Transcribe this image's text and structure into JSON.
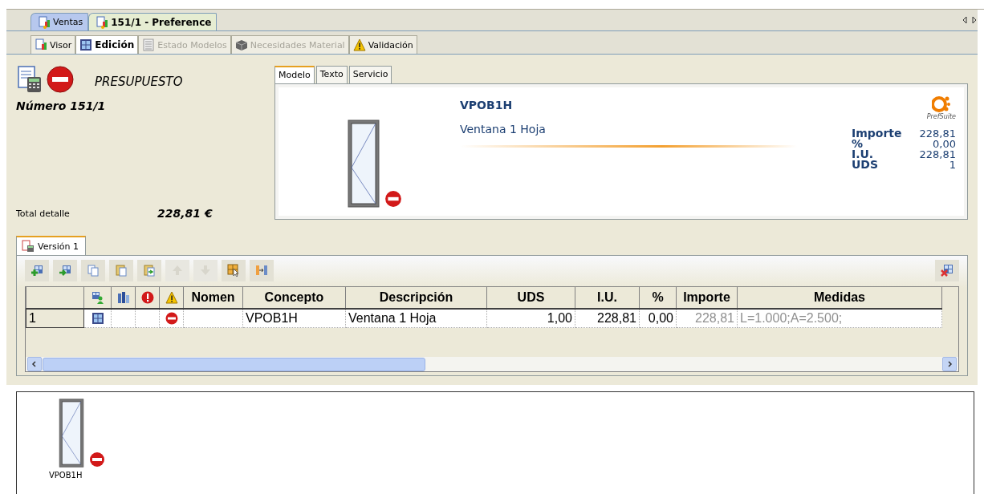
{
  "document_tabs": [
    {
      "label": "Ventas",
      "selected": false
    },
    {
      "label": "151/1 - Preference",
      "selected": true
    }
  ],
  "view_tabs": [
    {
      "label": "Visor",
      "kind": "doc",
      "selected": false,
      "disabled": false
    },
    {
      "label": "Edición",
      "kind": "grid",
      "selected": true,
      "disabled": false
    },
    {
      "label": "Estado Modelos",
      "kind": "list",
      "selected": false,
      "disabled": true
    },
    {
      "label": "Necesidades Material",
      "kind": "box",
      "selected": false,
      "disabled": true
    },
    {
      "label": "Validación",
      "kind": "warning",
      "selected": false,
      "disabled": false
    }
  ],
  "header": {
    "title": "PRESUPUESTO",
    "number": "Número 151/1",
    "total_label": "Total detalle",
    "total_value": "228,81 €"
  },
  "model_card": {
    "tabs": [
      {
        "label": "Modelo",
        "selected": true
      },
      {
        "label": "Texto",
        "selected": false
      },
      {
        "label": "Servicio",
        "selected": false
      }
    ],
    "code": "VPOB1H",
    "description": "Ventana 1 Hoja",
    "logo_text": "PrefSuite",
    "summary": [
      {
        "label": "Importe",
        "value": "228,81"
      },
      {
        "label": "%",
        "value": "0,00"
      },
      {
        "label": "I.U.",
        "value": "228,81"
      },
      {
        "label": "UDS",
        "value": "1"
      }
    ]
  },
  "version_tab": {
    "label": "Versión 1",
    "selected": true
  },
  "toolbar": [
    {
      "kind": "add",
      "disabled": false
    },
    {
      "kind": "move",
      "disabled": false
    },
    {
      "kind": "copy",
      "disabled": false
    },
    {
      "kind": "paste",
      "disabled": false
    },
    {
      "kind": "paste-special",
      "disabled": false
    },
    {
      "kind": "up",
      "disabled": true
    },
    {
      "kind": "down",
      "disabled": true
    },
    {
      "kind": "select",
      "disabled": false
    },
    {
      "kind": "split",
      "disabled": false
    }
  ],
  "toolbar_right": [
    {
      "kind": "delete",
      "disabled": false
    }
  ],
  "table": {
    "columns": [
      {
        "kind": "blank"
      },
      {
        "kind": "tree"
      },
      {
        "kind": "books"
      },
      {
        "kind": "error"
      },
      {
        "kind": "warning"
      },
      {
        "kind": "text",
        "label": "Nomen"
      },
      {
        "kind": "text",
        "label": "Concepto",
        "dimmed": false
      },
      {
        "kind": "text",
        "label": "Descripción",
        "dimmed": false
      },
      {
        "kind": "text",
        "label": "UDS",
        "dimmed": false
      },
      {
        "kind": "text",
        "label": "I.U.",
        "dimmed": false
      },
      {
        "kind": "text",
        "label": "%",
        "dimmed": false
      },
      {
        "kind": "text",
        "label": "Importe",
        "dimmed": true
      },
      {
        "kind": "text",
        "label": "Medidas",
        "dimmed": true
      }
    ],
    "rows": [
      {
        "cells": [
          {
            "text": "1"
          },
          {
            "kind": "grid"
          },
          {},
          {},
          {
            "kind": "stop"
          },
          {},
          {
            "text": "VPOB1H"
          },
          {
            "text": "Ventana 1 Hoja"
          },
          {
            "text": "1,00"
          },
          {
            "text": "228,81"
          },
          {
            "text": "0,00"
          },
          {
            "text": "228,81"
          },
          {
            "text": "L=1.000;A=2.500;"
          }
        ]
      }
    ]
  },
  "gallery": [
    {
      "label": "VPOB1H",
      "kind": "stop"
    }
  ]
}
